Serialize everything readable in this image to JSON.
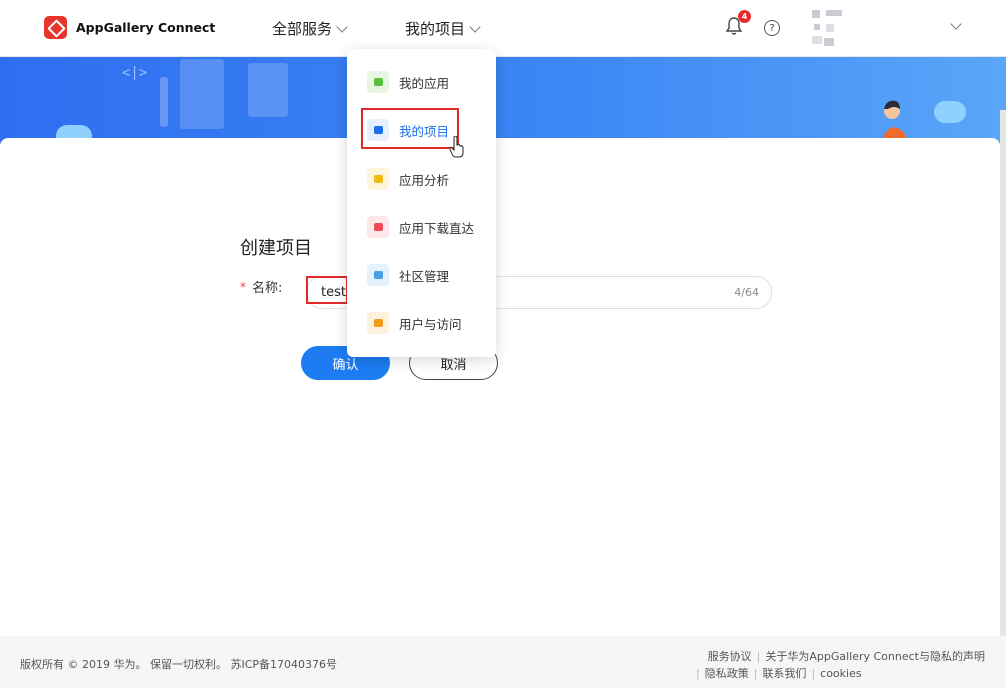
{
  "header": {
    "logo_text": "AppGallery Connect",
    "nav": [
      {
        "label": "全部服务"
      },
      {
        "label": "我的项目"
      }
    ],
    "notification_count": "4",
    "help_glyph": "?"
  },
  "form": {
    "title": "创建项目",
    "required_mark": "*",
    "name_label": "名称:",
    "name_value": "test",
    "char_count": "4/64",
    "confirm_label": "确认",
    "cancel_label": "取消"
  },
  "dropdown": {
    "items": [
      {
        "label": "我的应用",
        "icon": "apps-icon",
        "color": "#e8f5e1",
        "accent": "#5cbf39"
      },
      {
        "label": "我的项目",
        "icon": "project-icon",
        "color": "#e5effd",
        "accent": "#1d6fe8"
      },
      {
        "label": "应用分析",
        "icon": "analytics-icon",
        "color": "#fdf5dc",
        "accent": "#f2b90f"
      },
      {
        "label": "应用下载直达",
        "icon": "download-icon",
        "color": "#fde7e8",
        "accent": "#ee4a55"
      },
      {
        "label": "社区管理",
        "icon": "community-icon",
        "color": "#e3f2fd",
        "accent": "#4aa0e6"
      },
      {
        "label": "用户与访问",
        "icon": "user-access-icon",
        "color": "#fdf0dc",
        "accent": "#f39a1a"
      }
    ]
  },
  "banner": {
    "code_symbol": "<|>"
  },
  "footer": {
    "copyright": "版权所有 © 2019 华为。 保留一切权利。 苏ICP备17040376号",
    "links_line1": [
      "服务协议",
      "关于华为AppGallery Connect与隐私的声明"
    ],
    "links_line2": [
      "隐私政策",
      "联系我们",
      "cookies"
    ]
  },
  "colors": {
    "primary": "#1d7cf2",
    "highlight": "#e02a2a",
    "brand_red": "#e7352b"
  }
}
